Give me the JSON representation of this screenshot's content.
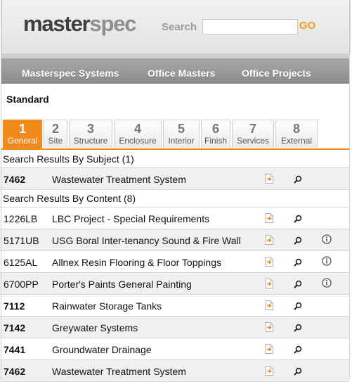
{
  "header": {
    "logo_dark": "master",
    "logo_light": "spec",
    "search_label": "Search",
    "search_value": "",
    "go_label": "GO"
  },
  "nav": [
    "Masterspec Systems",
    "Office Masters",
    "Office Projects"
  ],
  "section_title": "Standard",
  "tabs": [
    {
      "num": "1",
      "label": "General",
      "active": true
    },
    {
      "num": "2",
      "label": "Site"
    },
    {
      "num": "3",
      "label": "Structure"
    },
    {
      "num": "4",
      "label": "Enclosure"
    },
    {
      "num": "5",
      "label": "Interior"
    },
    {
      "num": "6",
      "label": "Finish"
    },
    {
      "num": "7",
      "label": "Services"
    },
    {
      "num": "8",
      "label": "External"
    }
  ],
  "results": {
    "by_subject_header": "Search Results By Subject (1)",
    "by_subject": [
      {
        "code": "7462",
        "title": "Wastewater Treatment System",
        "bold": true,
        "info": false
      }
    ],
    "by_content_header": "Search Results By Content (8)",
    "by_content": [
      {
        "code": "1226LB",
        "title": "LBC Project - Special Requirements",
        "bold": false,
        "info": false
      },
      {
        "code": "5171UB",
        "title": "USG Boral Inter-tenancy Sound & Fire Wall",
        "bold": false,
        "info": true
      },
      {
        "code": "6125AL",
        "title": "Allnex Resin Flooring & Floor Toppings",
        "bold": false,
        "info": true
      },
      {
        "code": "6700PP",
        "title": "Porter's Paints General Painting",
        "bold": false,
        "info": true
      },
      {
        "code": "7112",
        "title": "Rainwater Storage Tanks",
        "bold": true,
        "info": false
      },
      {
        "code": "7142",
        "title": "Greywater Systems",
        "bold": true,
        "info": false
      },
      {
        "code": "7441",
        "title": "Groundwater Drainage",
        "bold": true,
        "info": false
      },
      {
        "code": "7462",
        "title": "Wastewater Treatment System",
        "bold": true,
        "info": false
      }
    ]
  },
  "colors": {
    "accent": "#f08a1c",
    "go": "#f29b25",
    "nav": "#999999"
  },
  "icons": {
    "document": "document-icon",
    "search": "magnifier-icon",
    "info": "info-icon"
  }
}
